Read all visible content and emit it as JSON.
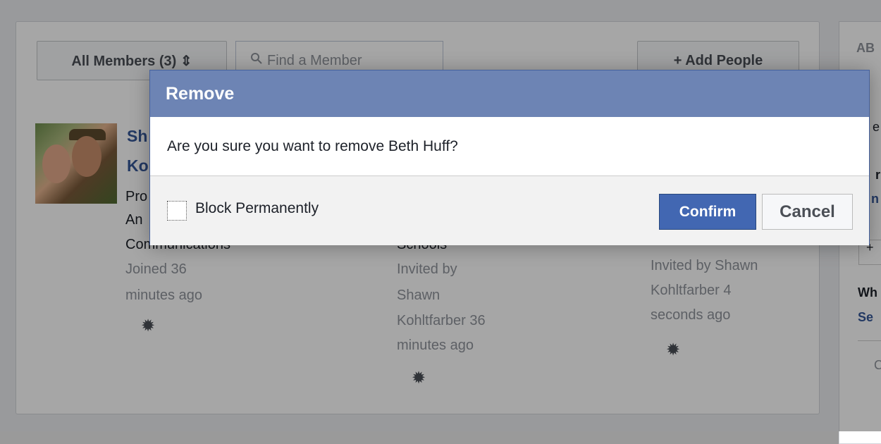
{
  "toolbar": {
    "filter_label": "All Members (3) ⇕",
    "search_icon": "search-icon",
    "search_placeholder": "Find a Member",
    "add_people_label": "+ Add People"
  },
  "members": [
    {
      "name_lines": [
        "Sh",
        "Ko"
      ],
      "info_lines": [
        "Pro",
        "An",
        "Communications"
      ],
      "joined": [
        "Joined 36",
        "minutes ago"
      ]
    },
    {
      "info_lines": [
        "Schools",
        "Invited by",
        "Shawn",
        "Kohltfarber 36",
        "minutes ago"
      ]
    },
    {
      "info_lines": [
        "Invited by Shawn",
        "Kohltfarber 4",
        "seconds ago"
      ]
    }
  ],
  "sidebar": {
    "fragments": [
      "AB",
      "e",
      "r",
      "n",
      "+",
      "Wh",
      "Se",
      "C"
    ]
  },
  "dialog": {
    "title": "Remove",
    "message": "Are you sure you want to remove Beth Huff?",
    "checkbox_label": "Block Permanently",
    "confirm_label": "Confirm",
    "cancel_label": "Cancel"
  },
  "colors": {
    "header": "#6d84b4",
    "confirm": "#4267b2",
    "link": "#365899"
  }
}
